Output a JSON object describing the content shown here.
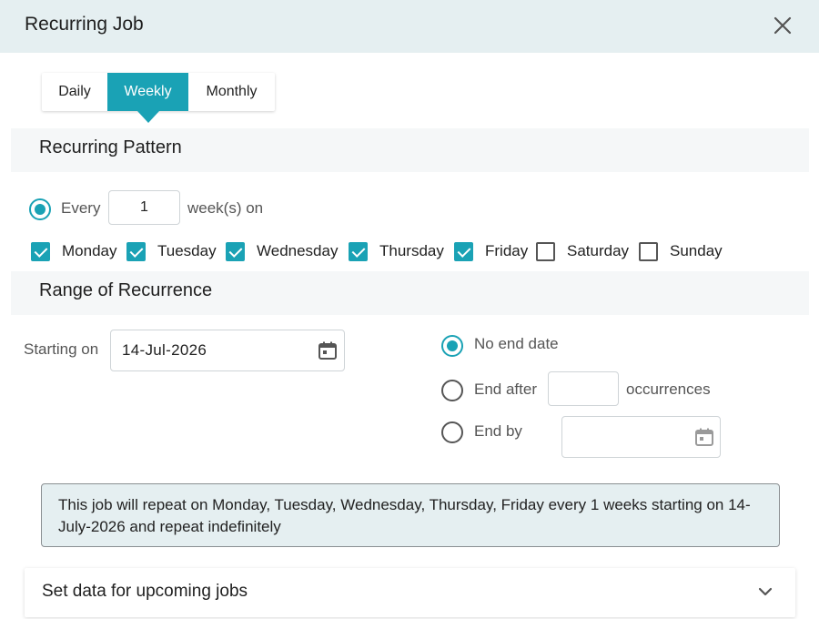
{
  "dialog": {
    "title": "Recurring Job",
    "close_icon": "close-icon"
  },
  "tabs": [
    {
      "label": "Daily",
      "active": false
    },
    {
      "label": "Weekly",
      "active": true
    },
    {
      "label": "Monthly",
      "active": false
    }
  ],
  "pattern": {
    "title": "Recurring Pattern",
    "every_label": "Every",
    "every_value": "1",
    "unit_label": "week(s) on",
    "days": [
      {
        "label": "Monday",
        "checked": true
      },
      {
        "label": "Tuesday",
        "checked": true
      },
      {
        "label": "Wednesday",
        "checked": true
      },
      {
        "label": "Thursday",
        "checked": true
      },
      {
        "label": "Friday",
        "checked": true
      },
      {
        "label": "Saturday",
        "checked": false
      },
      {
        "label": "Sunday",
        "checked": false
      }
    ]
  },
  "range": {
    "title": "Range of Recurrence",
    "starting_label": "Starting on",
    "start_date": "14-Jul-2026",
    "no_end_label": "No end date",
    "end_after_label": "End after",
    "end_after_value": "",
    "occurrences_label": "occurrences",
    "end_by_label": "End by",
    "end_by_value": "",
    "selected": "no_end"
  },
  "summary": {
    "text": "This job will repeat on Monday, Tuesday, Wednesday, Thursday, Friday every 1 weeks starting on 14-July-2026 and repeat indefinitely"
  },
  "upcoming": {
    "title": "Set data for upcoming jobs",
    "icon": "chevron-down-icon"
  },
  "colors": {
    "accent": "#1aa2b5",
    "header_bg": "#e5eff1",
    "section_bg": "#f5f7f8"
  }
}
